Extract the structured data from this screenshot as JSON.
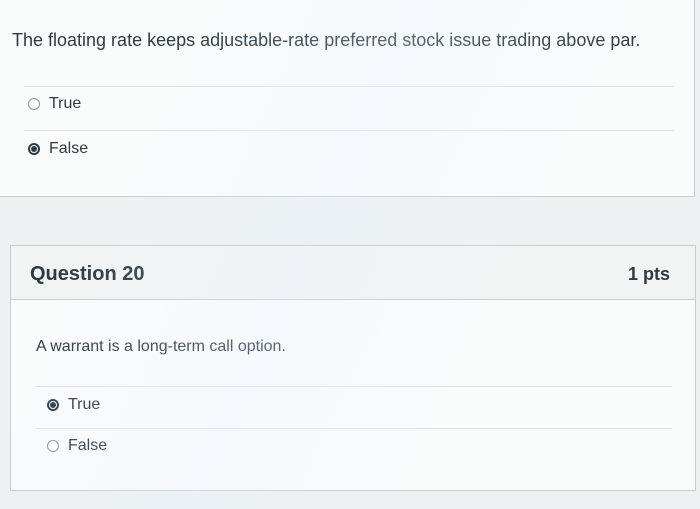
{
  "previous_question": {
    "text": "The floating rate keeps adjustable-rate preferred stock issue trading above par.",
    "answers": [
      {
        "label": "True",
        "selected": false
      },
      {
        "label": "False",
        "selected": true
      }
    ]
  },
  "question_20": {
    "title": "Question 20",
    "points": "1 pts",
    "text": "A warrant is a long-term call option.",
    "answers": [
      {
        "label": "True",
        "selected": true
      },
      {
        "label": "False",
        "selected": false
      }
    ]
  }
}
